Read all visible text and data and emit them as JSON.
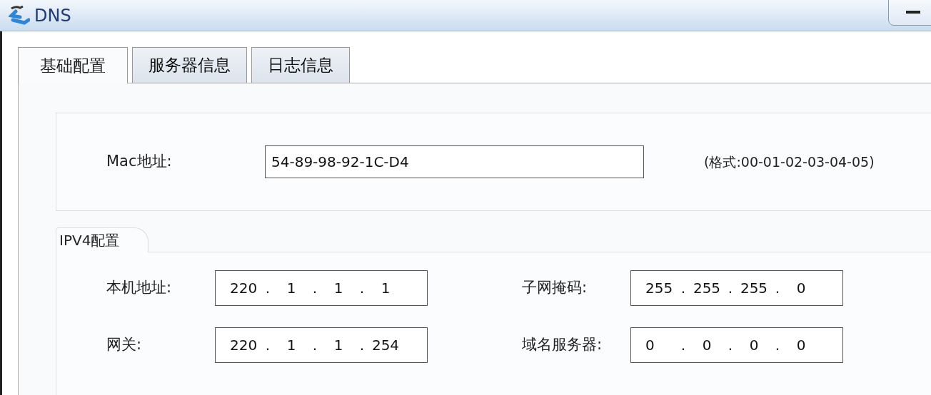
{
  "window": {
    "title": "DNS"
  },
  "tabs": [
    {
      "label": "基础配置",
      "selected": true
    },
    {
      "label": "服务器信息",
      "selected": false
    },
    {
      "label": "日志信息",
      "selected": false
    }
  ],
  "mac": {
    "label": "Mac地址:",
    "value": "54-89-98-92-1C-D4",
    "hint": "(格式:00-01-02-03-04-05)"
  },
  "ipv4": {
    "title": "IPV4配置",
    "fields": [
      {
        "label": "本机地址:",
        "octets": [
          "220",
          "1",
          "1",
          "1"
        ],
        "dots": [
          ".",
          ".",
          "."
        ]
      },
      {
        "label": "子网掩码:",
        "octets": [
          "255",
          "255",
          "255",
          "0"
        ],
        "dots": [
          ".",
          ".",
          "."
        ]
      },
      {
        "label": "网关:",
        "octets": [
          "220",
          "1",
          "1",
          "254"
        ],
        "dots": [
          ".",
          ".",
          "."
        ]
      },
      {
        "label": "域名服务器:",
        "octets": [
          "0",
          "0",
          "0",
          "0"
        ],
        "dots": [
          ".",
          ".",
          "."
        ]
      }
    ]
  }
}
